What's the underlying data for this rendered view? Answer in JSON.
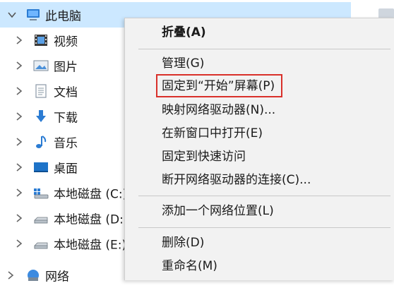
{
  "tree": {
    "items": [
      {
        "label": "此电脑",
        "icon": "computer-icon"
      },
      {
        "label": "视频",
        "icon": "video-folder-icon"
      },
      {
        "label": "图片",
        "icon": "pictures-folder-icon"
      },
      {
        "label": "文档",
        "icon": "documents-folder-icon"
      },
      {
        "label": "下载",
        "icon": "downloads-folder-icon"
      },
      {
        "label": "音乐",
        "icon": "music-folder-icon"
      },
      {
        "label": "桌面",
        "icon": "desktop-folder-icon"
      },
      {
        "label": "本地磁盘 (C:)",
        "icon": "system-drive-icon"
      },
      {
        "label": "本地磁盘 (D:)",
        "icon": "drive-icon"
      },
      {
        "label": "本地磁盘 (E:)",
        "icon": "drive-icon"
      },
      {
        "label": "网络",
        "icon": "network-icon"
      }
    ]
  },
  "context_menu": {
    "items": [
      {
        "label": "折叠(A)",
        "bold": true
      },
      {
        "label": "管理(G)"
      },
      {
        "label": "固定到“开始”屏幕(P)",
        "highlighted": true
      },
      {
        "label": "映射网络驱动器(N)..."
      },
      {
        "label": "在新窗口中打开(E)"
      },
      {
        "label": "固定到快速访问"
      },
      {
        "label": "断开网络驱动器的连接(C)..."
      },
      {
        "label": "添加一个网络位置(L)"
      },
      {
        "label": "删除(D)"
      },
      {
        "label": "重命名(M)"
      }
    ]
  },
  "colors": {
    "selection": "#cce8ff",
    "menu_background": "#f2f2f2",
    "highlight_border": "#d9302a"
  }
}
